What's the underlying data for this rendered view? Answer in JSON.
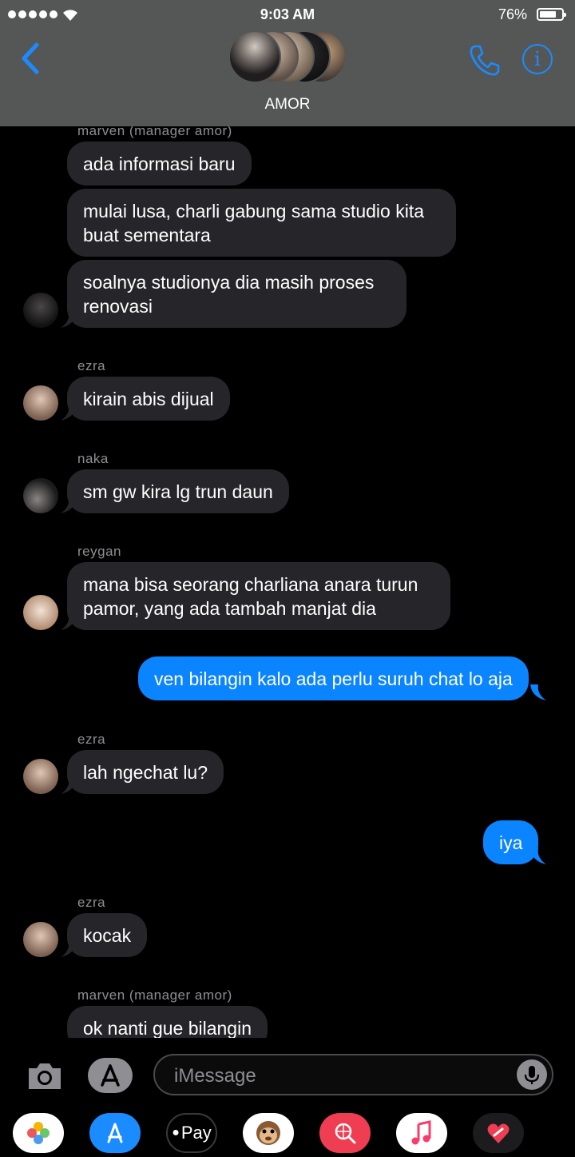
{
  "status": {
    "time": "9:03 AM",
    "battery": "76%",
    "battery_level": 0.76
  },
  "nav": {
    "group_name": "AMOR"
  },
  "messages": [
    {
      "sender": "marven (manager amor)",
      "texts": [
        "ada informasi baru",
        "mulai lusa, charli gabung sama studio kita buat sementara",
        "soalnya studionya dia masih proses renovasi"
      ]
    },
    {
      "sender": "ezra",
      "texts": [
        "kirain abis dijual"
      ]
    },
    {
      "sender": "naka",
      "texts": [
        "sm gw kira lg trun daun"
      ]
    },
    {
      "sender": "reygan",
      "texts": [
        "mana bisa seorang charliana anara turun pamor, yang ada tambah manjat dia"
      ]
    },
    {
      "sender": "me",
      "texts": [
        "ven bilangin kalo ada perlu suruh chat lo aja"
      ]
    },
    {
      "sender": "ezra",
      "texts": [
        "lah ngechat lu?"
      ]
    },
    {
      "sender": "me",
      "texts": [
        "iya"
      ]
    },
    {
      "sender": "ezra",
      "texts": [
        "kocak"
      ]
    },
    {
      "sender": "marven (manager amor)",
      "texts": [
        "ok nanti gue bilangin"
      ]
    }
  ],
  "composer": {
    "placeholder": "iMessage"
  },
  "app_drawer": {
    "apple_pay_label": "Pay"
  },
  "colors": {
    "accent": "#0a84ff",
    "incoming_bubble": "#26252a",
    "header_bg": "#555757"
  }
}
